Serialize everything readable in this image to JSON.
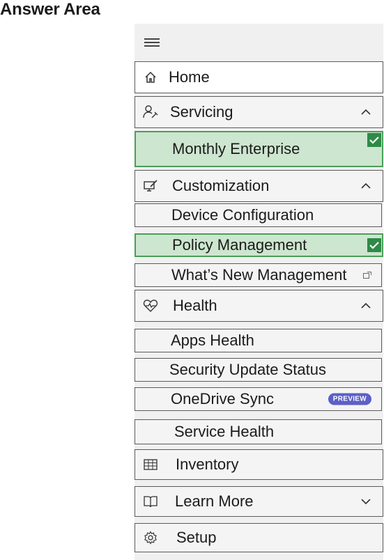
{
  "answer_area": {
    "title": "Answer Area"
  },
  "menu": {
    "icon": "hamburger-icon"
  },
  "nav": {
    "home": {
      "label": "Home",
      "icon": "home-icon"
    },
    "servicing": {
      "label": "Servicing",
      "icon": "people-wrench-icon",
      "expanded": true,
      "children": [
        {
          "label": "Monthly Enterprise",
          "selected": true
        }
      ]
    },
    "customization": {
      "label": "Customization",
      "icon": "pen-monitor-icon",
      "expanded": true,
      "children": [
        {
          "label": "Device Configuration",
          "selected": false
        },
        {
          "label": "Policy Management",
          "selected": true
        },
        {
          "label": "What’s New Management",
          "selected": false,
          "icon": "external-link-icon"
        }
      ]
    },
    "health": {
      "label": "Health",
      "icon": "heart-pulse-icon",
      "expanded": true,
      "children": [
        {
          "label": "Apps Health"
        },
        {
          "label": "Security Update Status"
        },
        {
          "label": "OneDrive Sync",
          "badge": "PREVIEW"
        },
        {
          "label": "Service Health"
        }
      ]
    },
    "inventory": {
      "label": "Inventory",
      "icon": "table-icon"
    },
    "learn_more": {
      "label": "Learn More",
      "icon": "book-icon",
      "expanded": false
    },
    "setup": {
      "label": "Setup",
      "icon": "gear-icon"
    }
  },
  "colors": {
    "selected_bg": "#cde6cf",
    "selected_border": "#4a9e59",
    "check": "#2f8a47",
    "preview_badge": "#5b5fc7"
  }
}
